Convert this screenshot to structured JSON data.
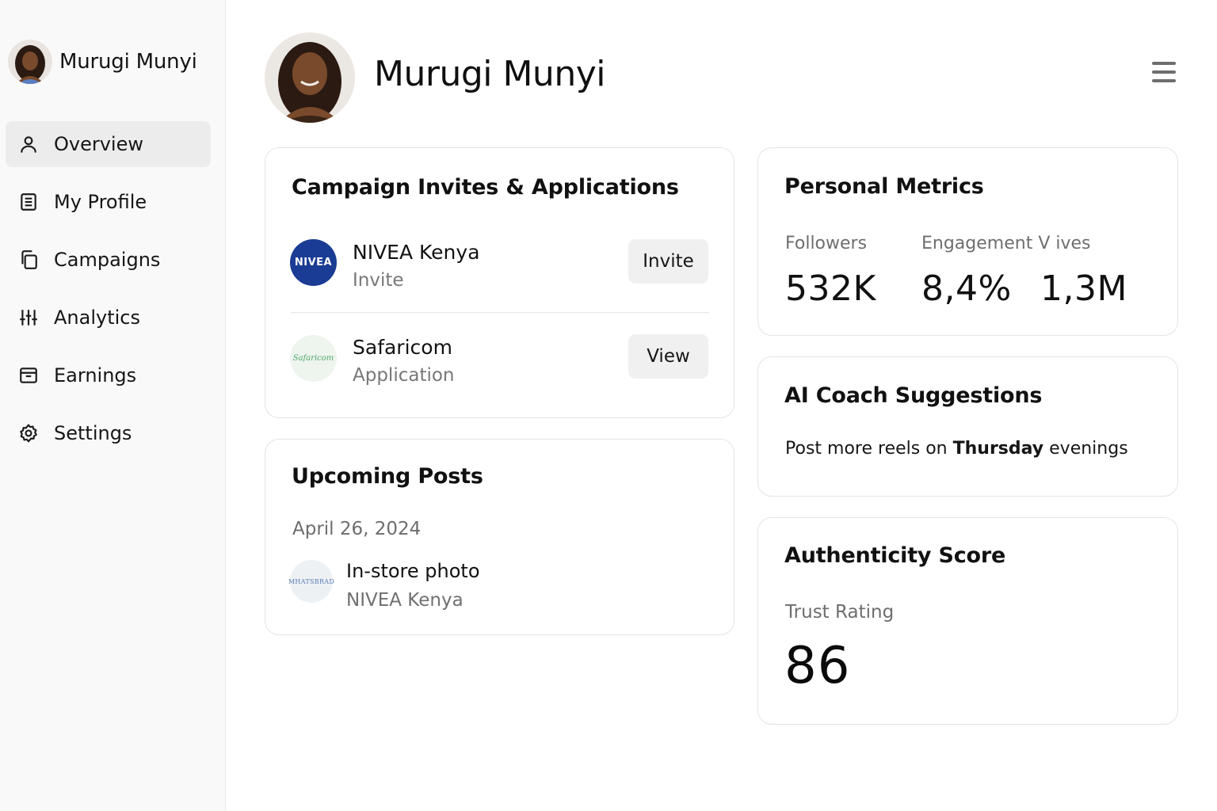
{
  "user": {
    "name": "Murugi Munyi"
  },
  "sidebar": {
    "items": [
      {
        "label": "Overview",
        "icon": "user-icon",
        "active": true
      },
      {
        "label": "My Profile",
        "icon": "document-icon"
      },
      {
        "label": "Campaigns",
        "icon": "copy-icon"
      },
      {
        "label": "Analytics",
        "icon": "sliders-icon"
      },
      {
        "label": "Earnings",
        "icon": "archive-icon"
      },
      {
        "label": "Settings",
        "icon": "gear-icon"
      }
    ]
  },
  "header": {
    "name": "Murugi Munyi",
    "menu_icon": "hamburger-menu-icon"
  },
  "campaigns": {
    "title": "Campaign Invites & Applications",
    "rows": [
      {
        "brand": "NIVEA Kenya",
        "type": "Invite",
        "button": "Invite",
        "logo_text": "NIVEA",
        "logo_color": "#1a3c94"
      },
      {
        "brand": "Safaricom",
        "type": "Application",
        "button": "View",
        "logo_text": "Safaricom"
      }
    ]
  },
  "posts": {
    "title": "Upcoming Posts",
    "date": "April 26, 2024",
    "items": [
      {
        "title": "In-store photo",
        "brand": "NIVEA Kenya",
        "logo_text": "MHATSBRAD"
      }
    ]
  },
  "metrics": {
    "title": "Personal Metrics",
    "labels": {
      "followers": "Followers",
      "engagement": "Engagement V ives"
    },
    "values": {
      "followers": "532K",
      "engagement": "8,4%",
      "views": "1,3M"
    }
  },
  "coach": {
    "title": "AI Coach Suggestions",
    "text_before": "Post more reels on ",
    "text_bold": "Thursday",
    "text_after": " evenings"
  },
  "authenticity": {
    "title": "Authenticity Score",
    "label": "Trust Rating",
    "value": "86"
  },
  "colors": {
    "sidebar_bg": "#f9f9f9",
    "active_item_bg": "#ececec",
    "nivea_blue": "#1a3c94"
  }
}
